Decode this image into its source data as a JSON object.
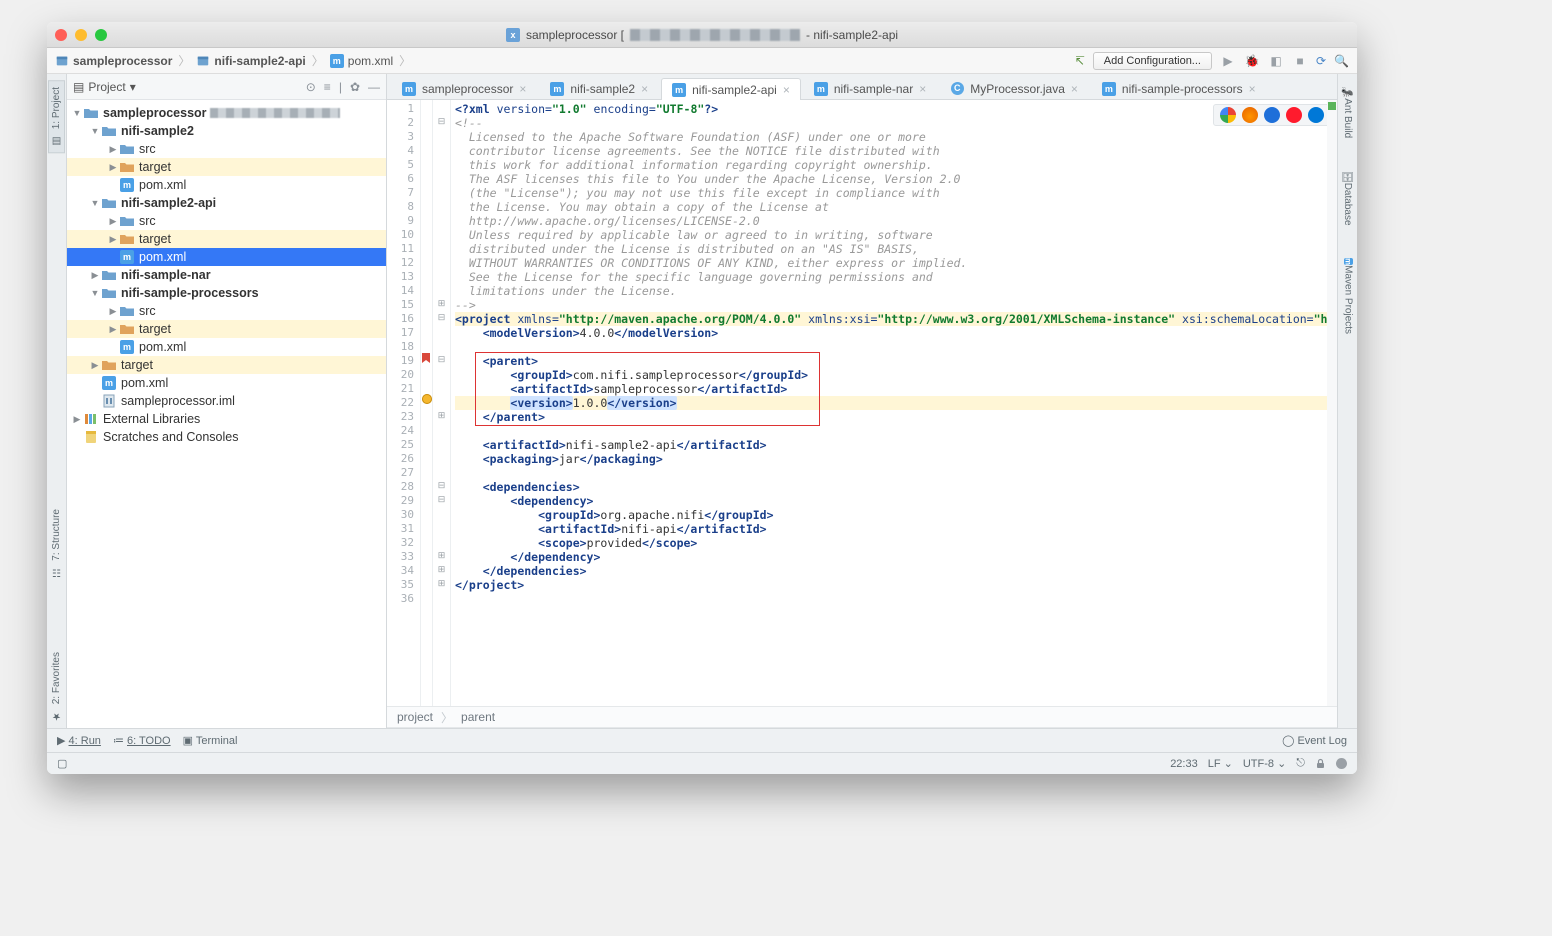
{
  "title": {
    "prefix": "sampleprocessor [",
    "suffix": "- nifi-sample2-api"
  },
  "breadcrumbs": [
    "sampleprocessor",
    "nifi-sample2-api",
    "pom.xml"
  ],
  "add_config": "Add Configuration...",
  "sidebar": {
    "title": "Project",
    "root": "sampleprocessor",
    "nodes": [
      {
        "d": 1,
        "caret": "v",
        "icon": "folder-blue",
        "label": "nifi-sample2",
        "bold": true
      },
      {
        "d": 2,
        "caret": ">",
        "icon": "folder-blue",
        "label": "src"
      },
      {
        "d": 2,
        "caret": ">",
        "icon": "folder-orange",
        "label": "target",
        "hl": true
      },
      {
        "d": 2,
        "caret": "",
        "icon": "m",
        "label": "pom.xml"
      },
      {
        "d": 1,
        "caret": "v",
        "icon": "folder-blue",
        "label": "nifi-sample2-api",
        "bold": true
      },
      {
        "d": 2,
        "caret": ">",
        "icon": "folder-blue",
        "label": "src"
      },
      {
        "d": 2,
        "caret": ">",
        "icon": "folder-orange",
        "label": "target",
        "hl": true
      },
      {
        "d": 2,
        "caret": "",
        "icon": "m",
        "label": "pom.xml",
        "sel": true
      },
      {
        "d": 1,
        "caret": ">",
        "icon": "folder-blue",
        "label": "nifi-sample-nar",
        "bold": true
      },
      {
        "d": 1,
        "caret": "v",
        "icon": "folder-blue",
        "label": "nifi-sample-processors",
        "bold": true
      },
      {
        "d": 2,
        "caret": ">",
        "icon": "folder-blue",
        "label": "src"
      },
      {
        "d": 2,
        "caret": ">",
        "icon": "folder-orange",
        "label": "target",
        "hl": true
      },
      {
        "d": 2,
        "caret": "",
        "icon": "m",
        "label": "pom.xml"
      },
      {
        "d": 1,
        "caret": ">",
        "icon": "folder-orange",
        "label": "target",
        "hl": true
      },
      {
        "d": 1,
        "caret": "",
        "icon": "m",
        "label": "pom.xml"
      },
      {
        "d": 1,
        "caret": "",
        "icon": "iml",
        "label": "sampleprocessor.iml"
      }
    ],
    "extlib": "External Libraries",
    "scratch": "Scratches and Consoles"
  },
  "tabs": [
    {
      "icon": "m",
      "label": "sampleprocessor"
    },
    {
      "icon": "m",
      "label": "nifi-sample2"
    },
    {
      "icon": "m",
      "label": "nifi-sample2-api",
      "active": true
    },
    {
      "icon": "m",
      "label": "nifi-sample-nar"
    },
    {
      "icon": "c",
      "label": "MyProcessor.java"
    },
    {
      "icon": "m",
      "label": "nifi-sample-processors"
    }
  ],
  "code_lines": [
    {
      "n": 1,
      "html": "<span class='tg'>&lt;?xml</span> <span class='at'>version=</span><span class='st'>\"1.0\"</span> <span class='at'>encoding=</span><span class='st'>\"UTF-8\"</span><span class='tg'>?&gt;</span>"
    },
    {
      "n": 2,
      "html": "<span class='cm'>&lt;!--</span>"
    },
    {
      "n": 3,
      "html": "<span class='cm'>  Licensed to the Apache Software Foundation (ASF) under one or more</span>"
    },
    {
      "n": 4,
      "html": "<span class='cm'>  contributor license agreements. See the NOTICE file distributed with</span>"
    },
    {
      "n": 5,
      "html": "<span class='cm'>  this work for additional information regarding copyright ownership.</span>"
    },
    {
      "n": 6,
      "html": "<span class='cm'>  The ASF licenses this file to You under the Apache License, Version 2.0</span>"
    },
    {
      "n": 7,
      "html": "<span class='cm'>  (the \"License\"); you may not use this file except in compliance with</span>"
    },
    {
      "n": 8,
      "html": "<span class='cm'>  the License. You may obtain a copy of the License at</span>"
    },
    {
      "n": 9,
      "html": "<span class='cm'>  http://www.apache.org/licenses/LICENSE-2.0</span>"
    },
    {
      "n": 10,
      "html": "<span class='cm'>  Unless required by applicable law or agreed to in writing, software</span>"
    },
    {
      "n": 11,
      "html": "<span class='cm'>  distributed under the License is distributed on an \"AS IS\" BASIS,</span>"
    },
    {
      "n": 12,
      "html": "<span class='cm'>  WITHOUT WARRANTIES OR CONDITIONS OF ANY KIND, either express or implied.</span>"
    },
    {
      "n": 13,
      "html": "<span class='cm'>  See the License for the specific language governing permissions and</span>"
    },
    {
      "n": 14,
      "html": "<span class='cm'>  limitations under the License.</span>"
    },
    {
      "n": 15,
      "html": "<span class='cm'>--&gt;</span>"
    },
    {
      "n": 16,
      "hl": true,
      "html": "<span class='tg'>&lt;project</span> <span class='at'>xmlns=</span><span class='st'>\"http://maven.apache.org/POM/4.0.0\"</span> <span class='at'>xmlns:xsi=</span><span class='st'>\"http://www.w3.org/2001/XMLSchema-instance\"</span> <span class='at'>xsi:schemaLocation=</span><span class='st'>\"http://maven.a</span>"
    },
    {
      "n": 17,
      "html": "    <span class='tg'>&lt;modelVersion&gt;</span><span class='tx'>4.0.0</span><span class='tg'>&lt;/modelVersion&gt;</span>"
    },
    {
      "n": 18,
      "html": ""
    },
    {
      "n": 19,
      "html": "    <span class='tg'>&lt;parent&gt;</span>"
    },
    {
      "n": 20,
      "html": "        <span class='tg'>&lt;groupId&gt;</span><span class='tx'>com.nifi.sampleprocessor</span><span class='tg'>&lt;/groupId&gt;</span>"
    },
    {
      "n": 21,
      "html": "        <span class='tg'>&lt;artifactId&gt;</span><span class='tx'>sampleprocessor</span><span class='tg'>&lt;/artifactId&gt;</span>"
    },
    {
      "n": 22,
      "hl": true,
      "html": "        <span class='selword'><span class='tg'>&lt;version&gt;</span></span><span class='tx'>1.0.0</span><span class='selword'><span class='tg'>&lt;/version&gt;</span></span>"
    },
    {
      "n": 23,
      "html": "    <span class='tg'>&lt;/parent&gt;</span>"
    },
    {
      "n": 24,
      "html": ""
    },
    {
      "n": 25,
      "html": "    <span class='tg'>&lt;artifactId&gt;</span><span class='tx'>nifi-sample2-api</span><span class='tg'>&lt;/artifactId&gt;</span>"
    },
    {
      "n": 26,
      "html": "    <span class='tg'>&lt;packaging&gt;</span><span class='tx'>jar</span><span class='tg'>&lt;/packaging&gt;</span>"
    },
    {
      "n": 27,
      "html": ""
    },
    {
      "n": 28,
      "html": "    <span class='tg'>&lt;dependencies&gt;</span>"
    },
    {
      "n": 29,
      "html": "        <span class='tg'>&lt;dependency&gt;</span>"
    },
    {
      "n": 30,
      "html": "            <span class='tg'>&lt;groupId&gt;</span><span class='tx'>org.apache.nifi</span><span class='tg'>&lt;/groupId&gt;</span>"
    },
    {
      "n": 31,
      "html": "            <span class='tg'>&lt;artifactId&gt;</span><span class='tx'>nifi-api</span><span class='tg'>&lt;/artifactId&gt;</span>"
    },
    {
      "n": 32,
      "html": "            <span class='tg'>&lt;scope&gt;</span><span class='tx'>provided</span><span class='tg'>&lt;/scope&gt;</span>"
    },
    {
      "n": 33,
      "html": "        <span class='tg'>&lt;/dependency&gt;</span>"
    },
    {
      "n": 34,
      "html": "    <span class='tg'>&lt;/dependencies&gt;</span>"
    },
    {
      "n": 35,
      "html": "<span class='tg'>&lt;/project&gt;</span>"
    },
    {
      "n": 36,
      "html": ""
    }
  ],
  "editor_breadcrumb": [
    "project",
    "parent"
  ],
  "left_tools": {
    "project": "1: Project",
    "structure": "7: Structure",
    "favorites": "2: Favorites"
  },
  "right_tools": {
    "ant": "Ant Build",
    "db": "Database",
    "maven": "Maven Projects"
  },
  "bottom_tools": {
    "run": "4: Run",
    "todo": "6: TODO",
    "terminal": "Terminal",
    "eventlog": "Event Log"
  },
  "status": {
    "pos": "22:33",
    "le": "LF",
    "enc": "UTF-8"
  }
}
